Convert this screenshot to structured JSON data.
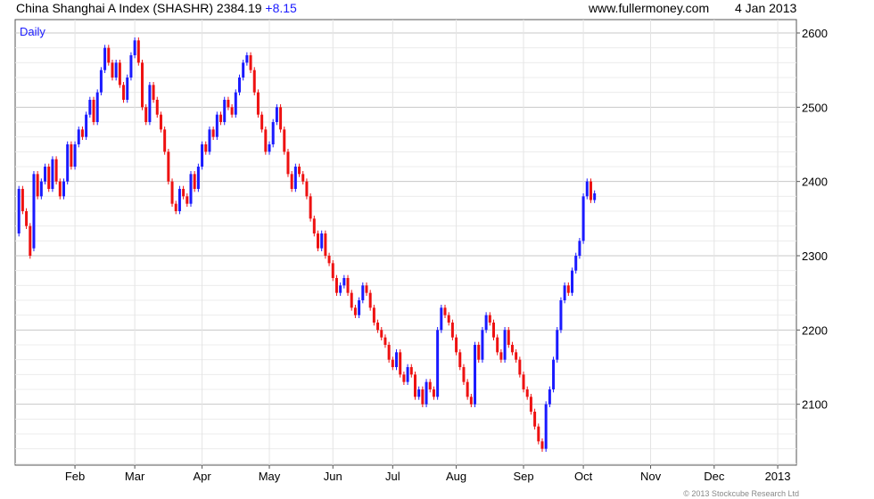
{
  "header": {
    "title": "China Shanghai A Index (SHASHR)",
    "last": "2384.19",
    "change": "+8.15",
    "source": "www.fullermoney.com",
    "date": "4 Jan 2013"
  },
  "copyright": "© 2013 Stockcube Research Ltd",
  "colors": {
    "up": "#1a1aff",
    "down": "#ee1111",
    "grid": "#dddddd",
    "frame": "#555555"
  },
  "chart_data": {
    "type": "candlestick",
    "period_label": "Daily",
    "ylim": [
      2018,
      2618
    ],
    "y_ticks": [
      2100,
      2200,
      2300,
      2400,
      2500,
      2600
    ],
    "x_labels": [
      {
        "label": "Feb",
        "t": 15
      },
      {
        "label": "Mar",
        "t": 31
      },
      {
        "label": "Apr",
        "t": 49
      },
      {
        "label": "May",
        "t": 67
      },
      {
        "label": "Jun",
        "t": 84
      },
      {
        "label": "Jul",
        "t": 100
      },
      {
        "label": "Aug",
        "t": 117
      },
      {
        "label": "Sep",
        "t": 135
      },
      {
        "label": "Oct",
        "t": 151
      },
      {
        "label": "Nov",
        "t": 169
      },
      {
        "label": "Dec",
        "t": 186
      },
      {
        "label": "2013",
        "t": 203
      }
    ],
    "t_range": [
      -1,
      208
    ],
    "grid": true,
    "series": [
      {
        "values": [
          [
            0,
            2330,
            2390
          ],
          [
            1,
            2390,
            2360
          ],
          [
            2,
            2360,
            2340
          ],
          [
            3,
            2340,
            2300
          ],
          [
            4,
            2310,
            2410
          ],
          [
            5,
            2410,
            2380
          ],
          [
            6,
            2380,
            2400
          ],
          [
            7,
            2400,
            2420
          ],
          [
            8,
            2420,
            2390
          ],
          [
            9,
            2390,
            2430
          ],
          [
            10,
            2430,
            2400
          ],
          [
            11,
            2400,
            2380
          ],
          [
            12,
            2380,
            2400
          ],
          [
            13,
            2400,
            2450
          ],
          [
            14,
            2450,
            2420
          ],
          [
            15,
            2420,
            2450
          ],
          [
            16,
            2450,
            2470
          ],
          [
            17,
            2470,
            2460
          ],
          [
            18,
            2460,
            2490
          ],
          [
            19,
            2490,
            2510
          ],
          [
            20,
            2510,
            2480
          ],
          [
            21,
            2480,
            2520
          ],
          [
            22,
            2520,
            2550
          ],
          [
            23,
            2550,
            2580
          ],
          [
            24,
            2580,
            2560
          ],
          [
            25,
            2560,
            2540
          ],
          [
            26,
            2540,
            2560
          ],
          [
            27,
            2560,
            2530
          ],
          [
            28,
            2530,
            2510
          ],
          [
            29,
            2510,
            2540
          ],
          [
            30,
            2540,
            2570
          ],
          [
            31,
            2570,
            2590
          ],
          [
            32,
            2590,
            2560
          ],
          [
            33,
            2560,
            2500
          ],
          [
            34,
            2500,
            2480
          ],
          [
            35,
            2480,
            2530
          ],
          [
            36,
            2530,
            2510
          ],
          [
            37,
            2510,
            2490
          ],
          [
            38,
            2490,
            2470
          ],
          [
            39,
            2470,
            2440
          ],
          [
            40,
            2440,
            2400
          ],
          [
            41,
            2400,
            2370
          ],
          [
            42,
            2370,
            2360
          ],
          [
            43,
            2360,
            2390
          ],
          [
            44,
            2390,
            2380
          ],
          [
            45,
            2380,
            2370
          ],
          [
            46,
            2370,
            2410
          ],
          [
            47,
            2410,
            2390
          ],
          [
            48,
            2390,
            2420
          ],
          [
            49,
            2420,
            2450
          ],
          [
            50,
            2450,
            2440
          ],
          [
            51,
            2440,
            2470
          ],
          [
            52,
            2470,
            2460
          ],
          [
            53,
            2460,
            2490
          ],
          [
            54,
            2490,
            2480
          ],
          [
            55,
            2480,
            2510
          ],
          [
            56,
            2510,
            2500
          ],
          [
            57,
            2500,
            2490
          ],
          [
            58,
            2490,
            2520
          ],
          [
            59,
            2520,
            2540
          ],
          [
            60,
            2540,
            2560
          ],
          [
            61,
            2560,
            2570
          ],
          [
            62,
            2570,
            2550
          ],
          [
            63,
            2550,
            2520
          ],
          [
            64,
            2520,
            2490
          ],
          [
            65,
            2490,
            2470
          ],
          [
            66,
            2470,
            2440
          ],
          [
            67,
            2440,
            2450
          ],
          [
            68,
            2450,
            2480
          ],
          [
            69,
            2480,
            2500
          ],
          [
            70,
            2500,
            2470
          ],
          [
            71,
            2470,
            2440
          ],
          [
            72,
            2440,
            2410
          ],
          [
            73,
            2410,
            2390
          ],
          [
            74,
            2390,
            2420
          ],
          [
            75,
            2420,
            2410
          ],
          [
            76,
            2410,
            2400
          ],
          [
            77,
            2400,
            2380
          ],
          [
            78,
            2380,
            2350
          ],
          [
            79,
            2350,
            2330
          ],
          [
            80,
            2330,
            2310
          ],
          [
            81,
            2310,
            2330
          ],
          [
            82,
            2330,
            2300
          ],
          [
            83,
            2300,
            2290
          ],
          [
            84,
            2290,
            2270
          ],
          [
            85,
            2270,
            2250
          ],
          [
            86,
            2250,
            2260
          ],
          [
            87,
            2260,
            2270
          ],
          [
            88,
            2270,
            2250
          ],
          [
            89,
            2250,
            2230
          ],
          [
            90,
            2230,
            2220
          ],
          [
            91,
            2220,
            2240
          ],
          [
            92,
            2240,
            2260
          ],
          [
            93,
            2260,
            2250
          ],
          [
            94,
            2250,
            2230
          ],
          [
            95,
            2230,
            2210
          ],
          [
            96,
            2210,
            2200
          ],
          [
            97,
            2200,
            2190
          ],
          [
            98,
            2190,
            2180
          ],
          [
            99,
            2180,
            2160
          ],
          [
            100,
            2160,
            2150
          ],
          [
            101,
            2150,
            2170
          ],
          [
            102,
            2170,
            2140
          ],
          [
            103,
            2140,
            2130
          ],
          [
            104,
            2130,
            2150
          ],
          [
            105,
            2150,
            2140
          ],
          [
            106,
            2140,
            2110
          ],
          [
            107,
            2110,
            2120
          ],
          [
            108,
            2120,
            2100
          ],
          [
            109,
            2100,
            2130
          ],
          [
            110,
            2130,
            2120
          ],
          [
            111,
            2120,
            2110
          ],
          [
            112,
            2110,
            2200
          ],
          [
            113,
            2200,
            2230
          ],
          [
            114,
            2230,
            2220
          ],
          [
            115,
            2220,
            2210
          ],
          [
            116,
            2210,
            2190
          ],
          [
            117,
            2190,
            2170
          ],
          [
            118,
            2170,
            2150
          ],
          [
            119,
            2150,
            2130
          ],
          [
            120,
            2130,
            2110
          ],
          [
            121,
            2110,
            2100
          ],
          [
            122,
            2100,
            2180
          ],
          [
            123,
            2180,
            2160
          ],
          [
            124,
            2160,
            2200
          ],
          [
            125,
            2200,
            2220
          ],
          [
            126,
            2220,
            2210
          ],
          [
            127,
            2210,
            2190
          ],
          [
            128,
            2190,
            2170
          ],
          [
            129,
            2170,
            2160
          ],
          [
            130,
            2160,
            2200
          ],
          [
            131,
            2200,
            2180
          ],
          [
            132,
            2180,
            2170
          ],
          [
            133,
            2170,
            2160
          ],
          [
            134,
            2160,
            2140
          ],
          [
            135,
            2140,
            2120
          ],
          [
            136,
            2120,
            2110
          ],
          [
            137,
            2110,
            2090
          ],
          [
            138,
            2090,
            2070
          ],
          [
            139,
            2070,
            2050
          ],
          [
            140,
            2050,
            2040
          ],
          [
            141,
            2040,
            2100
          ],
          [
            142,
            2100,
            2120
          ],
          [
            143,
            2120,
            2160
          ],
          [
            144,
            2160,
            2200
          ],
          [
            145,
            2200,
            2240
          ],
          [
            146,
            2240,
            2260
          ],
          [
            147,
            2260,
            2250
          ],
          [
            148,
            2250,
            2280
          ],
          [
            149,
            2280,
            2300
          ],
          [
            150,
            2300,
            2320
          ],
          [
            151,
            2320,
            2380
          ],
          [
            152,
            2380,
            2400
          ],
          [
            153,
            2400,
            2375
          ],
          [
            154,
            2375,
            2384
          ]
        ]
      }
    ]
  }
}
